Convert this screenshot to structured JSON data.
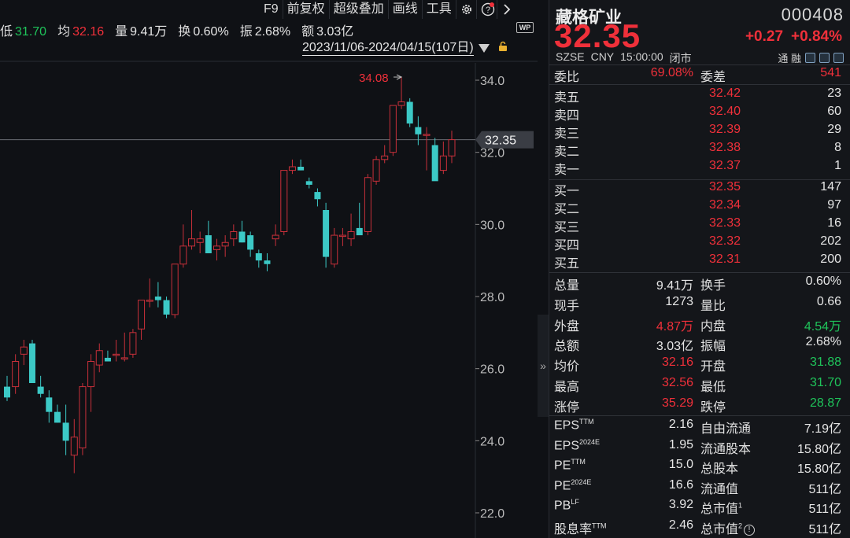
{
  "toolbar": {
    "items": [
      "F9",
      "前复权",
      "超级叠加",
      "画线",
      "工具"
    ],
    "icons": [
      "gear-icon",
      "help-icon",
      "chevron-right-icon"
    ]
  },
  "quote_strip": {
    "low_label": "低",
    "low_value": "31.70",
    "avg_label": "均",
    "avg_value": "32.16",
    "vol_label": "量",
    "vol_value": "9.41万",
    "turnover_label": "换",
    "turnover_value": "0.60%",
    "amp_label": "振",
    "amp_value": "2.68%",
    "amount_label": "额",
    "amount_value": "3.03亿"
  },
  "wp_badge": "WP",
  "range_label": "2023/11/06-2024/04/15(107日)",
  "chart_data": {
    "type": "candlestick",
    "y_ticks": [
      "34.0",
      "32.0",
      "30.0",
      "28.0",
      "26.0",
      "24.0",
      "22.0"
    ],
    "ylim": [
      21.9,
      34.5
    ],
    "current_price_label": "32.35",
    "current_price": 32.35,
    "max_label": "34.08",
    "max_value": 34.08,
    "candles": [
      [
        25.5,
        25.8,
        25.1,
        25.2
      ],
      [
        25.5,
        26.4,
        25.3,
        26.2
      ],
      [
        26.4,
        26.8,
        26.1,
        26.6
      ],
      [
        26.7,
        26.8,
        25.6,
        25.6
      ],
      [
        25.5,
        25.8,
        25.2,
        25.3
      ],
      [
        25.2,
        25.4,
        24.5,
        24.8
      ],
      [
        24.8,
        25.0,
        24.5,
        24.5
      ],
      [
        24.5,
        25.0,
        23.6,
        24.0
      ],
      [
        23.6,
        24.6,
        23.1,
        24.1
      ],
      [
        23.8,
        25.6,
        23.6,
        25.5
      ],
      [
        25.5,
        26.4,
        24.8,
        26.2
      ],
      [
        26.1,
        26.7,
        25.9,
        26.5
      ],
      [
        26.3,
        26.5,
        26.2,
        26.2
      ],
      [
        26.4,
        26.8,
        26.2,
        26.4
      ],
      [
        26.3,
        27.0,
        26.2,
        26.3
      ],
      [
        26.4,
        27.1,
        26.3,
        27.0
      ],
      [
        27.1,
        27.9,
        26.8,
        27.9
      ],
      [
        27.9,
        28.5,
        27.7,
        27.9
      ],
      [
        28.0,
        28.4,
        27.7,
        27.9
      ],
      [
        27.9,
        28.0,
        27.4,
        27.5
      ],
      [
        27.5,
        28.9,
        27.4,
        28.9
      ],
      [
        28.9,
        30.0,
        28.8,
        29.4
      ],
      [
        29.4,
        30.4,
        29.3,
        29.6
      ],
      [
        29.5,
        29.8,
        29.2,
        29.6
      ],
      [
        29.7,
        30.1,
        29.3,
        29.2
      ],
      [
        29.3,
        29.6,
        29.0,
        29.4
      ],
      [
        29.4,
        29.7,
        29.1,
        29.5
      ],
      [
        29.6,
        30.0,
        29.4,
        29.8
      ],
      [
        29.8,
        30.1,
        29.5,
        29.5
      ],
      [
        29.7,
        29.8,
        29.1,
        29.3
      ],
      [
        29.2,
        29.3,
        28.8,
        29.0
      ],
      [
        29.0,
        29.2,
        28.7,
        28.9
      ],
      [
        29.6,
        30.0,
        29.4,
        29.7
      ],
      [
        29.8,
        31.5,
        29.7,
        31.5
      ],
      [
        31.5,
        31.8,
        31.4,
        31.6
      ],
      [
        31.6,
        31.8,
        31.5,
        31.5
      ],
      [
        31.2,
        31.3,
        31.0,
        31.1
      ],
      [
        30.9,
        31.0,
        30.5,
        30.7
      ],
      [
        30.4,
        30.6,
        28.8,
        29.1
      ],
      [
        28.9,
        29.9,
        28.8,
        29.7
      ],
      [
        29.7,
        29.9,
        29.4,
        29.7
      ],
      [
        29.6,
        30.3,
        29.4,
        29.8
      ],
      [
        29.9,
        30.6,
        29.8,
        29.7
      ],
      [
        29.8,
        31.4,
        29.7,
        31.3
      ],
      [
        31.2,
        31.9,
        31.1,
        31.8
      ],
      [
        31.8,
        32.2,
        31.7,
        31.9
      ],
      [
        32.0,
        33.2,
        31.9,
        33.3
      ],
      [
        33.3,
        34.1,
        33.2,
        33.4
      ],
      [
        33.4,
        33.5,
        32.7,
        32.8
      ],
      [
        32.7,
        33.0,
        32.2,
        32.5
      ],
      [
        32.5,
        32.7,
        31.5,
        32.5
      ],
      [
        32.2,
        32.4,
        31.4,
        31.2
      ],
      [
        31.5,
        32.3,
        31.4,
        31.9
      ],
      [
        31.9,
        32.6,
        31.7,
        32.35
      ]
    ]
  },
  "panel": {
    "name": "藏格矿业",
    "code": "000408",
    "price": "32.35",
    "change": "+0.27",
    "change_pct": "+0.84%",
    "meta": [
      "SZSE",
      "CNY",
      "15:00:00",
      "闭市"
    ],
    "meta_right": "通 融",
    "weibi_label": "委比",
    "weibi_value": "69.08%",
    "weicha_label": "委差",
    "weicha_value": "541",
    "asks": [
      {
        "label": "卖五",
        "price": "32.42",
        "vol": "23"
      },
      {
        "label": "卖四",
        "price": "32.40",
        "vol": "60"
      },
      {
        "label": "卖三",
        "price": "32.39",
        "vol": "29"
      },
      {
        "label": "卖二",
        "price": "32.38",
        "vol": "8"
      },
      {
        "label": "卖一",
        "price": "32.37",
        "vol": "1"
      }
    ],
    "bids": [
      {
        "label": "买一",
        "price": "32.35",
        "vol": "147"
      },
      {
        "label": "买二",
        "price": "32.34",
        "vol": "97"
      },
      {
        "label": "买三",
        "price": "32.33",
        "vol": "16"
      },
      {
        "label": "买四",
        "price": "32.32",
        "vol": "202"
      },
      {
        "label": "买五",
        "price": "32.31",
        "vol": "200"
      }
    ],
    "stats": [
      {
        "l1": "总量",
        "v1": "9.41万",
        "c1": "white",
        "l2": "换手",
        "v2": "0.60%",
        "c2": "white"
      },
      {
        "l1": "现手",
        "v1": "1273",
        "c1": "white",
        "l2": "量比",
        "v2": "0.66",
        "c2": "white"
      },
      {
        "l1": "外盘",
        "v1": "4.87万",
        "c1": "red",
        "l2": "内盘",
        "v2": "4.54万",
        "c2": "green"
      },
      {
        "l1": "总额",
        "v1": "3.03亿",
        "c1": "white",
        "l2": "振幅",
        "v2": "2.68%",
        "c2": "white"
      },
      {
        "l1": "均价",
        "v1": "32.16",
        "c1": "red",
        "l2": "开盘",
        "v2": "31.88",
        "c2": "green"
      },
      {
        "l1": "最高",
        "v1": "32.56",
        "c1": "red",
        "l2": "最低",
        "v2": "31.70",
        "c2": "green"
      },
      {
        "l1": "涨停",
        "v1": "35.29",
        "c1": "red",
        "l2": "跌停",
        "v2": "28.87",
        "c2": "green"
      }
    ],
    "fundamentals": [
      {
        "l1": "EPS",
        "s1": "TTM",
        "v1": "2.16",
        "l2": "自由流通",
        "s2": "",
        "v2": "7.19亿"
      },
      {
        "l1": "EPS",
        "s1": "2024E",
        "v1": "1.95",
        "l2": "流通股本",
        "s2": "",
        "v2": "15.80亿"
      },
      {
        "l1": "PE",
        "s1": "TTM",
        "v1": "15.0",
        "l2": "总股本",
        "s2": "",
        "v2": "15.80亿"
      },
      {
        "l1": "PE",
        "s1": "2024E",
        "v1": "16.6",
        "l2": "流通值",
        "s2": "",
        "v2": "511亿"
      },
      {
        "l1": "PB",
        "s1": "LF",
        "v1": "3.92",
        "l2": "总市值",
        "s2": "1",
        "v2": "511亿"
      },
      {
        "l1": "股息率",
        "s1": "TTM",
        "v1": "2.46",
        "l2": "总市值",
        "s2": "2",
        "v2": "511亿"
      }
    ]
  },
  "colors": {
    "up": "#f0303a",
    "down": "#1fc35a",
    "candle_down": "#3cc9c6"
  }
}
